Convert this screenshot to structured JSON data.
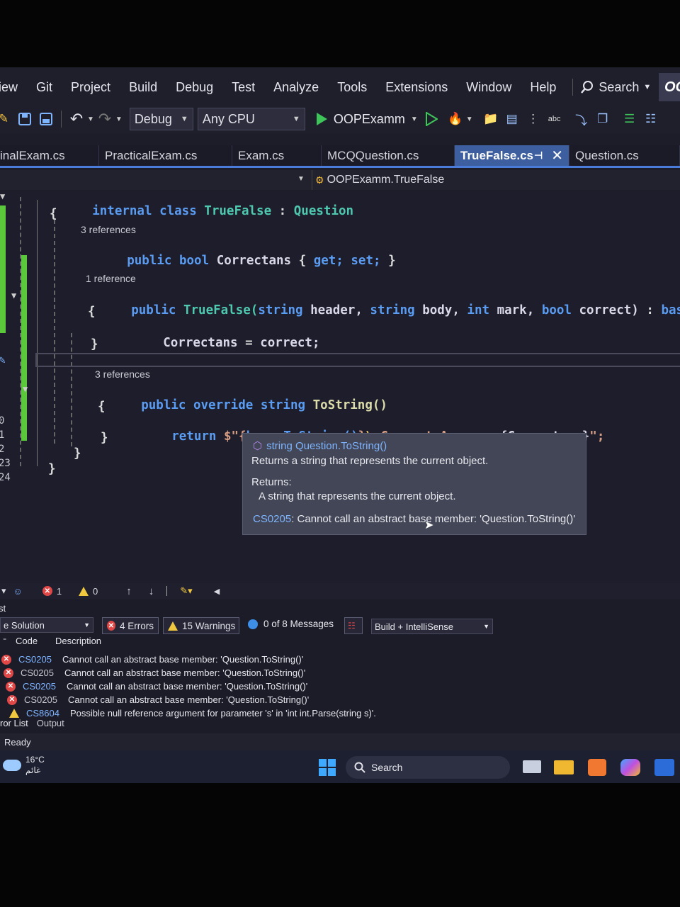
{
  "menu": [
    "iew",
    "Git",
    "Project",
    "Build",
    "Debug",
    "Test",
    "Analyze",
    "Tools",
    "Extensions",
    "Window",
    "Help"
  ],
  "search_label": "Search",
  "oo_badge": "OC",
  "toolbar": {
    "config": "Debug",
    "platform": "Any CPU",
    "run_target": "OOPExamm"
  },
  "tabs": [
    "inalExam.cs",
    "PracticalExam.cs",
    "Exam.cs",
    "MCQQuestion.cs",
    "TrueFalse.cs",
    "Question.cs"
  ],
  "active_tab": "TrueFalse.cs",
  "nav": {
    "member": "OOPExamm.TrueFalse"
  },
  "line_numbers": [
    "0",
    "1",
    "2",
    "23",
    "24"
  ],
  "code": {
    "class_line": [
      "internal",
      "class",
      "TrueFalse",
      ":",
      "Question"
    ],
    "lens1": "3 references",
    "prop_line": [
      "public",
      "bool",
      "Correctans",
      "{",
      "get;",
      "set;",
      "}"
    ],
    "lens2": "1 reference",
    "ctor_line": [
      "public",
      "TrueFalse(",
      "string",
      "header,",
      "string",
      "body,",
      "int",
      "mark,",
      "bool",
      "correct)",
      ":",
      "base(heade"
    ],
    "assign_line": [
      "Correctans",
      "=",
      "correct;"
    ],
    "lens3": "3 references",
    "tostring_line": [
      "public",
      "override",
      "string",
      "ToString()"
    ],
    "return_line": [
      "return",
      "$\"{",
      "base.ToString()",
      "}",
      "\\n",
      "Correct Answer: ",
      "{Correctans}",
      "\";"
    ]
  },
  "tooltip": {
    "signature": "string Question.ToString()",
    "summary": "Returns a string that represents the current object.",
    "returns_label": "Returns:",
    "returns_text": "A string that represents the current object.",
    "error_code": "CS0205",
    "error_text": ": Cannot call an abstract base member: 'Question.ToString()'"
  },
  "status_strip": {
    "errors": "1",
    "warnings": "0"
  },
  "error_list": {
    "title": "st",
    "scope": "e Solution",
    "errors_btn": "4 Errors",
    "warnings_btn": "15 Warnings",
    "messages_btn": "0 of 8 Messages",
    "filter": "Build + IntelliSense",
    "col_code": "Code",
    "col_desc": "Description",
    "rows": [
      {
        "type": "error",
        "code": "CS0205",
        "link": true,
        "desc": "Cannot call an abstract base member: 'Question.ToString()'"
      },
      {
        "type": "error",
        "code": "CS0205",
        "link": false,
        "desc": "Cannot call an abstract base member: 'Question.ToString()'"
      },
      {
        "type": "error",
        "code": "CS0205",
        "link": true,
        "desc": "Cannot call an abstract base member: 'Question.ToString()'"
      },
      {
        "type": "error",
        "code": "CS0205",
        "link": false,
        "desc": "Cannot call an abstract base member: 'Question.ToString()'"
      },
      {
        "type": "warning",
        "code": "CS8604",
        "link": true,
        "desc": "Possible null reference argument for parameter 's' in 'int int.Parse(string s)'."
      }
    ],
    "bottom_tabs": [
      "ror List",
      "Output"
    ]
  },
  "status_bar": "Ready",
  "taskbar": {
    "temp": "16°C",
    "weather": "غائم",
    "search": "Search"
  },
  "colors": {
    "keyword": "#5a9cf2",
    "type": "#4ec9b0",
    "accent": "#4b7bd8",
    "error": "#e04848",
    "warning": "#f0c840"
  }
}
